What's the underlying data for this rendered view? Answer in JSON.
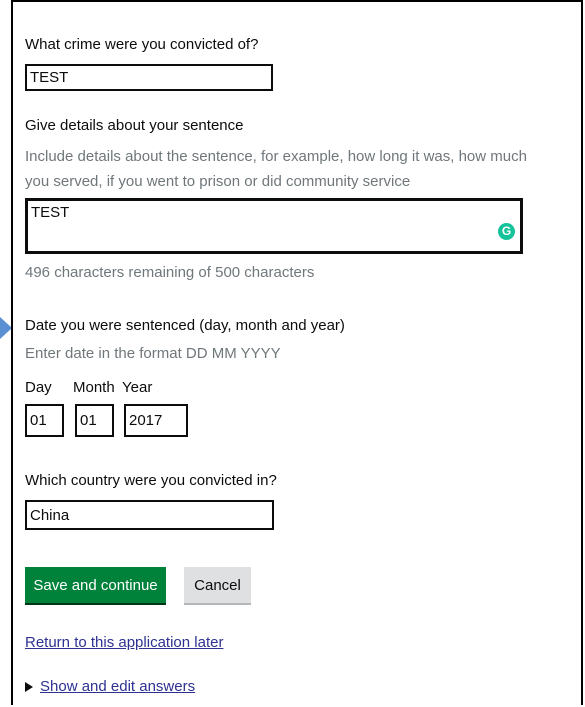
{
  "crime": {
    "label": "What crime were you convicted of?",
    "value": "TEST"
  },
  "sentence": {
    "label": "Give details about your sentence",
    "hint": "Include details about the sentence, for example, how long it was, how much you served, if you went to prison or did community service",
    "value": "TEST",
    "counter": "496 characters remaining of 500 characters"
  },
  "date": {
    "label": "Date you were sentenced (day, month and year)",
    "hint": "Enter date in the format DD MM YYYY",
    "day_label": "Day",
    "month_label": "Month",
    "year_label": "Year",
    "day_value": "01",
    "month_value": "01",
    "year_value": "2017"
  },
  "country": {
    "label": "Which country were you convicted in?",
    "value": "China"
  },
  "actions": {
    "save_label": "Save and continue",
    "cancel_label": "Cancel",
    "return_link": "Return to this application later",
    "show_answers_link": "Show and edit answers"
  },
  "colors": {
    "primary_button": "#00823b",
    "link": "#2e3191",
    "hint_text": "#6f777b",
    "grammarly": "#15c39a"
  },
  "icons": {
    "pointer": "blue-arrow-icon",
    "grammarly": "grammarly-icon",
    "disclosure": "triangle-right-icon"
  }
}
